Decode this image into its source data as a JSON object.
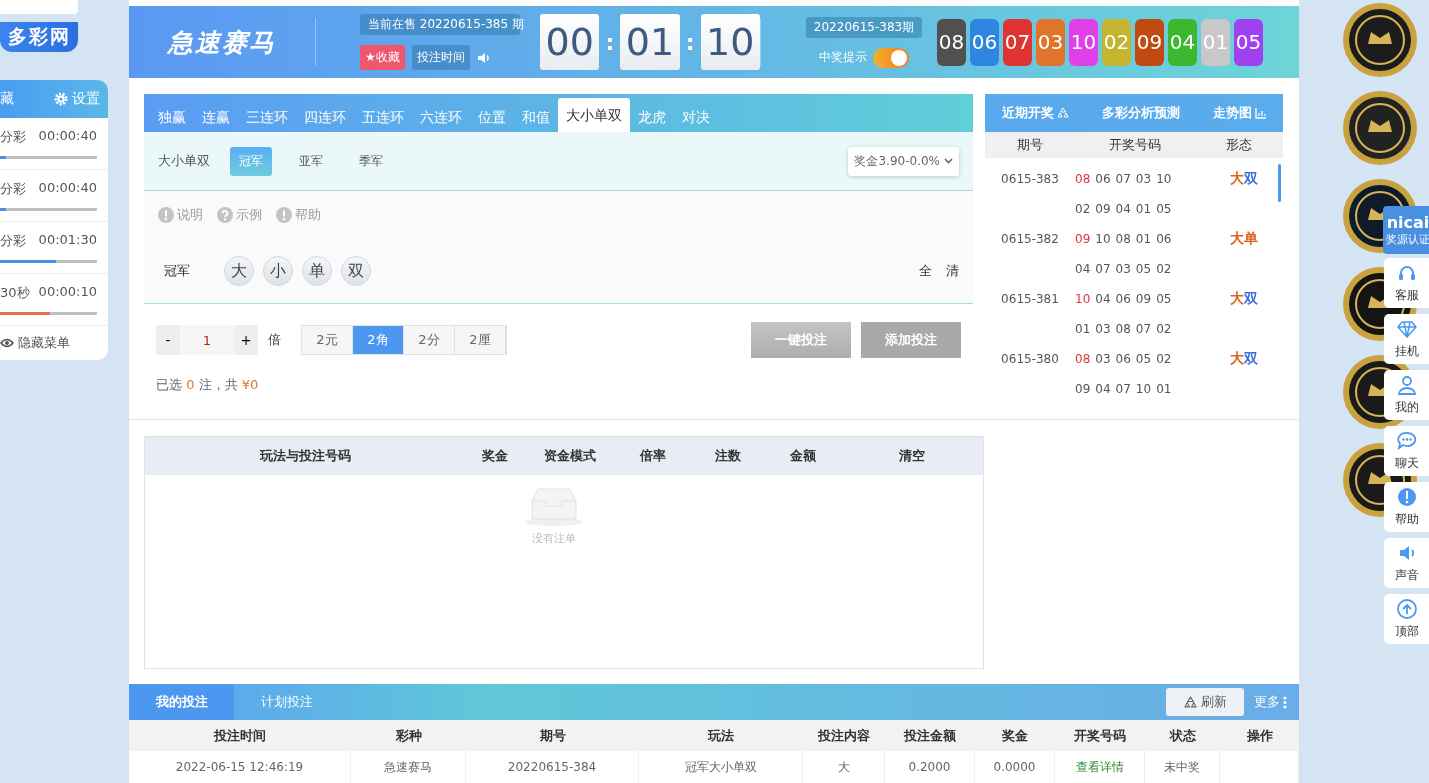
{
  "sidebar": {
    "logo": "多彩网",
    "header_left": "藏",
    "settings": "设置",
    "games": [
      {
        "name": "分彩",
        "time": "00:00:40",
        "level": 0.06,
        "color": "#4a90e2"
      },
      {
        "name": "分彩",
        "time": "00:00:40",
        "level": 0.06,
        "color": "#4a90e2"
      },
      {
        "name": "分彩",
        "time": "00:01:30",
        "level": 0.58,
        "color": "#4a90e2"
      },
      {
        "name": "30秒",
        "time": "00:00:10",
        "level": 0.52,
        "color": "#e8734a"
      }
    ],
    "hide_menu": "隐藏菜单"
  },
  "header": {
    "title": "急速赛马",
    "current": "当前在售 20220615-385 期",
    "favorite": "★收藏",
    "bet_time": "投注时间",
    "countdown": [
      "00",
      "01",
      "10"
    ],
    "separators": [
      ":",
      ":"
    ],
    "last_draw": "20220615-383期",
    "notify": {
      "label": "中奖提示",
      "on": true
    },
    "balls": [
      {
        "number": "08",
        "color": "#505050"
      },
      {
        "number": "06",
        "color": "#2f86e0"
      },
      {
        "number": "07",
        "color": "#e03434"
      },
      {
        "number": "03",
        "color": "#e0742a"
      },
      {
        "number": "10",
        "color": "#e040e8"
      },
      {
        "number": "02",
        "color": "#c4b430"
      },
      {
        "number": "09",
        "color": "#c04a10"
      },
      {
        "number": "04",
        "color": "#3cb830"
      },
      {
        "number": "01",
        "color": "#c8c8c8"
      },
      {
        "number": "05",
        "color": "#a040f0"
      }
    ]
  },
  "play": {
    "tabs": [
      {
        "label": "独赢",
        "selected": false
      },
      {
        "label": "连赢",
        "selected": false
      },
      {
        "label": "三连环",
        "selected": false
      },
      {
        "label": "四连环",
        "selected": false
      },
      {
        "label": "五连环",
        "selected": false
      },
      {
        "label": "六连环",
        "selected": false
      },
      {
        "label": "位置",
        "selected": false
      },
      {
        "label": "和值",
        "selected": false
      },
      {
        "label": "大小单双",
        "selected": true
      },
      {
        "label": "龙虎",
        "selected": false
      },
      {
        "label": "对决",
        "selected": false
      }
    ],
    "sub_label": "大小单双",
    "sub_tabs": [
      {
        "label": "冠军",
        "selected": true
      },
      {
        "label": "亚军",
        "selected": false
      },
      {
        "label": "季军",
        "selected": false
      }
    ],
    "prize_select": "奖金3.90-0.0%",
    "info_links": [
      {
        "label": "说明",
        "kind": "info"
      },
      {
        "label": "示例",
        "kind": "question"
      },
      {
        "label": "帮助",
        "kind": "info"
      }
    ],
    "pick_label": "冠军",
    "options": [
      {
        "label": "大",
        "selected": false
      },
      {
        "label": "小",
        "selected": false
      },
      {
        "label": "单",
        "selected": false
      },
      {
        "label": "双",
        "selected": false
      }
    ],
    "actions": [
      "全",
      "清"
    ],
    "multiplier": {
      "minus": "-",
      "value": "1",
      "plus": "+",
      "unit": "倍"
    },
    "units": [
      {
        "label": "2元",
        "selected": false
      },
      {
        "label": "2角",
        "selected": true
      },
      {
        "label": "2分",
        "selected": false
      },
      {
        "label": "2厘",
        "selected": false
      }
    ],
    "buttons": [
      {
        "label": "一键投注",
        "disabled": true
      },
      {
        "label": "添加投注",
        "disabled": true
      }
    ],
    "summary": {
      "prefix": "已选",
      "count": "0",
      "middle": "注，共",
      "amount": "¥0"
    }
  },
  "draws": {
    "tabs": [
      "近期开奖",
      "多彩分析预测",
      "走势图"
    ],
    "columns": [
      "期号",
      "开奖号码",
      "形态"
    ],
    "rows": [
      {
        "period": "0615-383",
        "numbers": [
          "08",
          "06",
          "07",
          "03",
          "10",
          "02",
          "09",
          "04",
          "01",
          "05"
        ],
        "shape": [
          {
            "text": "大",
            "color": "#e0601a"
          },
          {
            "text": "双",
            "color": "#3a6fd8"
          }
        ]
      },
      {
        "period": "0615-382",
        "numbers": [
          "09",
          "10",
          "08",
          "01",
          "06",
          "04",
          "07",
          "03",
          "05",
          "02"
        ],
        "shape": [
          {
            "text": "大",
            "color": "#e0601a"
          },
          {
            "text": "单",
            "color": "#e0601a"
          }
        ]
      },
      {
        "period": "0615-381",
        "numbers": [
          "10",
          "04",
          "06",
          "09",
          "05",
          "01",
          "03",
          "08",
          "07",
          "02"
        ],
        "shape": [
          {
            "text": "大",
            "color": "#e0601a"
          },
          {
            "text": "双",
            "color": "#3a6fd8"
          }
        ]
      },
      {
        "period": "0615-380",
        "numbers": [
          "08",
          "03",
          "06",
          "05",
          "02",
          "09",
          "04",
          "07",
          "10",
          "01"
        ],
        "shape": [
          {
            "text": "大",
            "color": "#e0601a"
          },
          {
            "text": "双",
            "color": "#3a6fd8"
          }
        ]
      }
    ]
  },
  "cart": {
    "columns": [
      "玩法与投注号码",
      "奖金",
      "资金模式",
      "倍率",
      "注数",
      "金额",
      "清空"
    ],
    "empty": "没有注单"
  },
  "bets": {
    "tabs": [
      {
        "label": "我的投注",
        "selected": true
      },
      {
        "label": "计划投注",
        "selected": false
      }
    ],
    "refresh": "刷新",
    "more": "更多",
    "columns": [
      "投注时间",
      "彩种",
      "期号",
      "玩法",
      "投注内容",
      "投注金额",
      "奖金",
      "开奖号码",
      "状态",
      "操作"
    ],
    "rows": [
      {
        "time": "2022-06-15 12:46:19",
        "lottery": "急速赛马",
        "period": "20220615-384",
        "play": "冠军大小单双",
        "content": "大",
        "amount": "0.2000",
        "prize": "0.0000",
        "detail": "查看详情",
        "status": "未中奖"
      }
    ]
  },
  "side": {
    "badge": {
      "brand": "nicai",
      "label": "奖源认证"
    },
    "buttons": [
      {
        "label": "客服",
        "kind": "headset"
      },
      {
        "label": "挂机",
        "kind": "diamond"
      },
      {
        "label": "我的",
        "kind": "user"
      },
      {
        "label": "聊天",
        "kind": "chat"
      },
      {
        "label": "帮助",
        "kind": "alert"
      },
      {
        "label": "声音",
        "kind": "sound"
      },
      {
        "label": "顶部",
        "kind": "top"
      }
    ]
  }
}
